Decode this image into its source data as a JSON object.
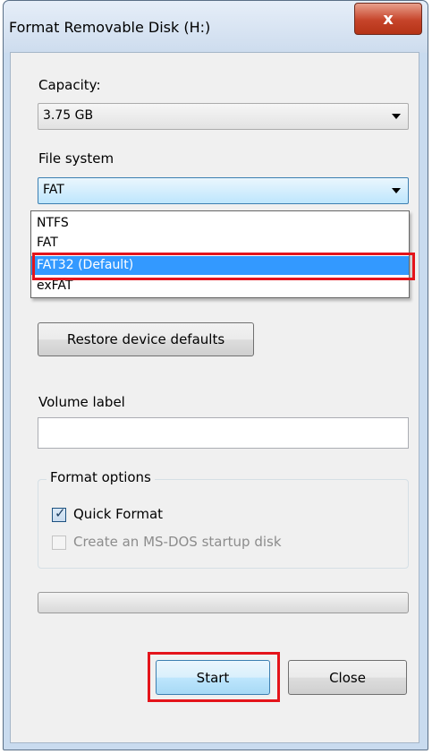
{
  "window": {
    "title": "Format Removable Disk (H:)",
    "close_glyph": "x"
  },
  "capacity": {
    "label": "Capacity:",
    "value": "3.75 GB"
  },
  "file_system": {
    "label": "File system",
    "value": "FAT",
    "options": [
      "NTFS",
      "FAT",
      "FAT32 (Default)",
      "exFAT"
    ],
    "highlighted": "FAT32 (Default)"
  },
  "restore_defaults_label": "Restore device defaults",
  "volume": {
    "label": "Volume label",
    "value": ""
  },
  "format_options": {
    "title": "Format options",
    "quick_format": {
      "label": "Quick Format",
      "checked": true
    },
    "msdos_startup": {
      "label": "Create an MS-DOS startup disk",
      "checked": false,
      "enabled": false
    }
  },
  "progress": {
    "fraction": 0
  },
  "buttons": {
    "start": "Start",
    "close": "Close"
  },
  "colors": {
    "selection": "#3399ff",
    "highlight_box": "#e4141b"
  }
}
